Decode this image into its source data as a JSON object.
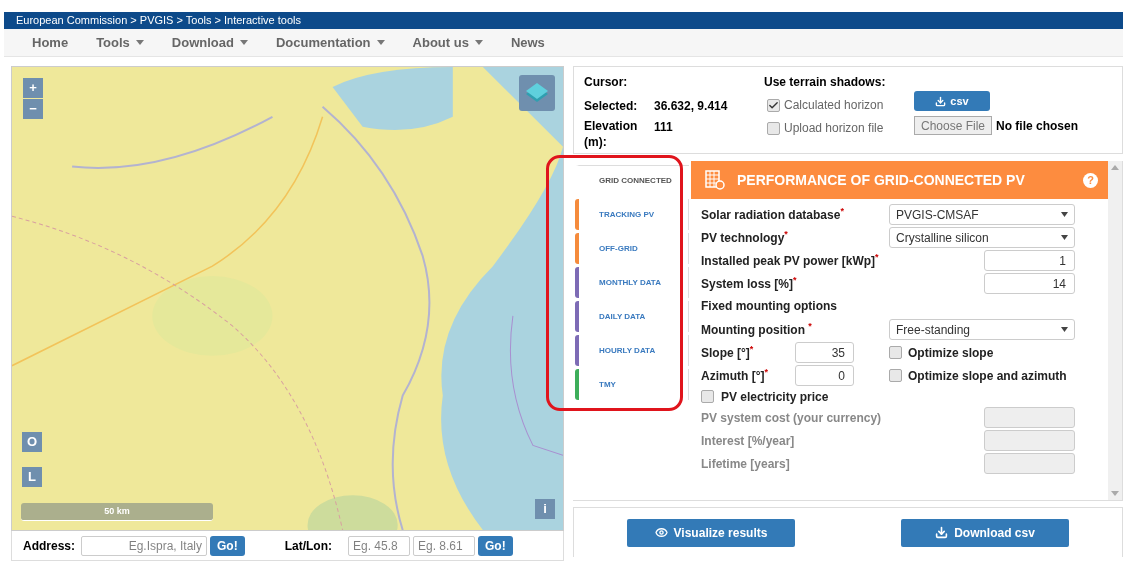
{
  "breadcrumb": "European Commission > PVGIS > Tools > Interactive tools",
  "nav": [
    {
      "label": "Home",
      "dropdown": false
    },
    {
      "label": "Tools",
      "dropdown": true
    },
    {
      "label": "Download",
      "dropdown": true
    },
    {
      "label": "Documentation",
      "dropdown": true
    },
    {
      "label": "About us",
      "dropdown": true
    },
    {
      "label": "News",
      "dropdown": false
    }
  ],
  "map": {
    "zoom_in": "+",
    "zoom_out": "−",
    "button_o": "O",
    "button_l": "L",
    "info": "i",
    "scale": "50 km"
  },
  "address_bar": {
    "address_label": "Address:",
    "address_placeholder": "Eg.Ispra, Italy",
    "go": "Go!",
    "latlon_label": "Lat/Lon:",
    "lat_placeholder": "Eg. 45.8",
    "lon_placeholder": "Eg. 8.61",
    "go2": "Go!"
  },
  "location": {
    "cursor_label": "Cursor:",
    "selected_label": "Selected:",
    "selected_value": "36.632, 9.414",
    "elevation_label": "Elevation (m):",
    "elevation_value": "111"
  },
  "shadows": {
    "title": "Use terrain shadows:",
    "options": [
      {
        "label": "Calculated horizon",
        "checked": true
      },
      {
        "label": "Upload horizon file",
        "checked": false
      }
    ],
    "csv_button": "csv",
    "file_button": "Choose File",
    "file_status": "No file chosen"
  },
  "tabs": [
    {
      "label": "GRID CONNECTED",
      "selected": true,
      "color": "#ffffff"
    },
    {
      "label": "TRACKING PV",
      "selected": false,
      "color": "#f58b3c"
    },
    {
      "label": "OFF-GRID",
      "selected": false,
      "color": "#f58b3c"
    },
    {
      "label": "MONTHLY DATA",
      "selected": false,
      "color": "#7d6bb5"
    },
    {
      "label": "DAILY DATA",
      "selected": false,
      "color": "#7d6bb5"
    },
    {
      "label": "HOURLY DATA",
      "selected": false,
      "color": "#7d6bb5"
    },
    {
      "label": "TMY",
      "selected": false,
      "color": "#3dae5a"
    }
  ],
  "panel": {
    "title": "PERFORMANCE OF GRID-CONNECTED PV",
    "help": "?",
    "database": {
      "label": "Solar radiation database$^{*}$",
      "value": "PVGIS-CMSAF"
    },
    "technology": {
      "label": "PV technology$^{*}$",
      "value": "Crystalline silicon"
    },
    "power": {
      "label": "Installed peak PV power [kWp]$^{*}$",
      "value": "1"
    },
    "loss": {
      "label": "System loss [%]$^{*}$",
      "value": "14"
    },
    "fixed_title": "Fixed mounting options",
    "mounting": {
      "label": "Mounting position $^{*}$",
      "value": "Free-standing"
    },
    "slope": {
      "label": "Slope [°]$^{*}$",
      "value": "35",
      "option": "Optimize slope",
      "checked": false
    },
    "azimuth": {
      "label": "Azimuth [°]$^{*}$",
      "value": "0",
      "option": "Optimize slope and azimuth",
      "checked": false
    },
    "price": {
      "label": "PV electricity price",
      "checked": false
    },
    "disabled_fields": [
      "PV system cost (your currency)",
      "Interest [%/year]",
      "Lifetime [years]"
    ]
  },
  "actions": [
    "Visualize results",
    "Download csv"
  ]
}
